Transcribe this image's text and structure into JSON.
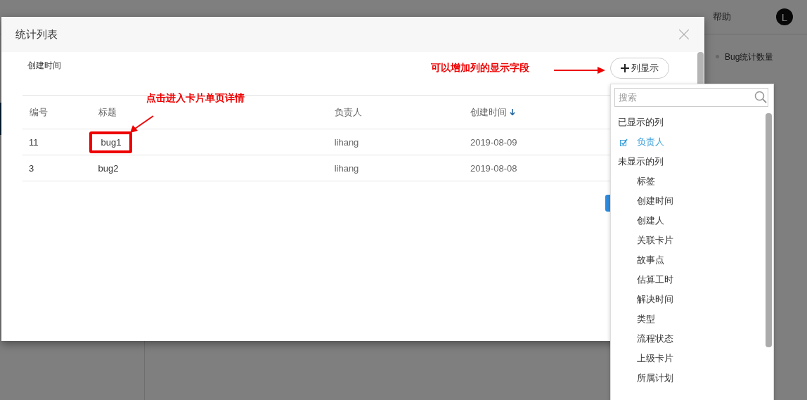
{
  "topbar": {
    "help": "帮助",
    "avatar": "L"
  },
  "side_panel": {
    "item": "Bug统计数量"
  },
  "dialog": {
    "title": "统计列表",
    "filter_label": "创建时间",
    "column_button": "列显示",
    "table": {
      "columns": [
        {
          "label": "编号",
          "sorted": false
        },
        {
          "label": "标题",
          "sorted": false
        },
        {
          "label": "负责人",
          "sorted": false
        },
        {
          "label": "创建时间",
          "sorted": true
        }
      ],
      "rows": [
        [
          "11",
          "bug1",
          "lihang",
          "2019-08-09"
        ],
        [
          "3",
          "bug2",
          "lihang",
          "2019-08-08"
        ]
      ]
    }
  },
  "annotations": [
    {
      "kind": "button_hint",
      "text": "可以增加列的显示字段"
    },
    {
      "kind": "title_hint",
      "text": "点击进入卡片单页详情"
    }
  ],
  "column_menu": {
    "search": {
      "placeholder": "搜索"
    },
    "groups": [
      {
        "title": "已显示的列",
        "items": [
          {
            "label": "负责人",
            "checked": true
          }
        ]
      },
      {
        "title": "未显示的列",
        "items": [
          {
            "label": "标签",
            "checked": false
          },
          {
            "label": "创建时间",
            "checked": false
          },
          {
            "label": "创建人",
            "checked": false
          },
          {
            "label": "关联卡片",
            "checked": false
          },
          {
            "label": "故事点",
            "checked": false
          },
          {
            "label": "估算工时",
            "checked": false
          },
          {
            "label": "解决时间",
            "checked": false
          },
          {
            "label": "类型",
            "checked": false
          },
          {
            "label": "流程状态",
            "checked": false
          },
          {
            "label": "上级卡片",
            "checked": false
          },
          {
            "label": "所属计划",
            "checked": false
          }
        ]
      }
    ]
  }
}
